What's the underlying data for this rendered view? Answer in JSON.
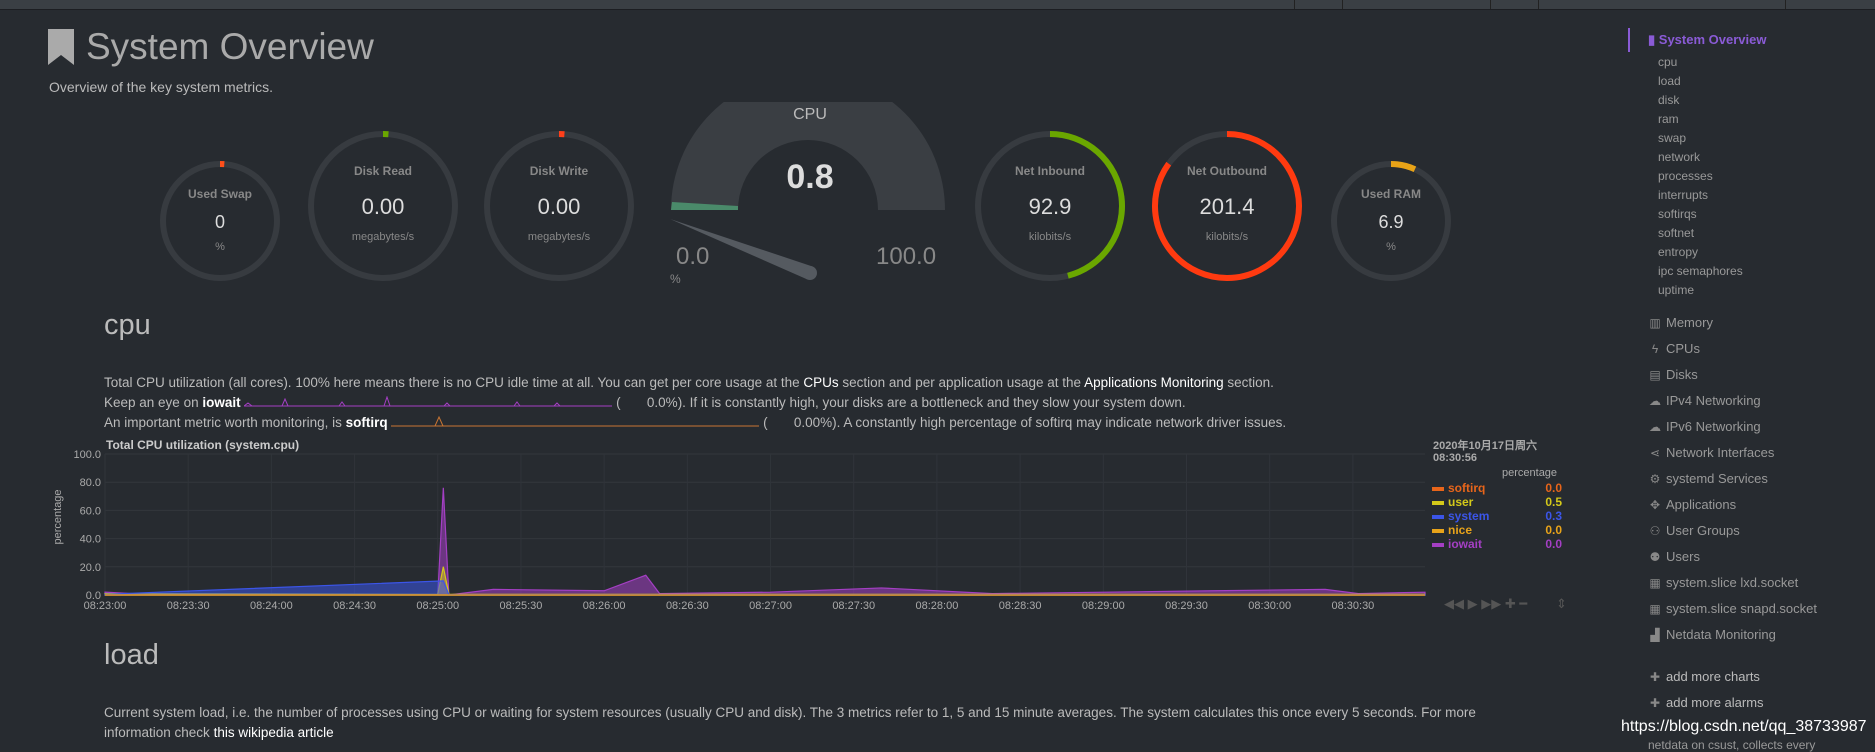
{
  "header": {
    "title": "System Overview",
    "subtitle": "Overview of the key system metrics."
  },
  "gauges": {
    "used_swap": {
      "title": "Used Swap",
      "value": "0",
      "unit": "%",
      "fill": 0.0,
      "color": "#ff4f1a"
    },
    "disk_read": {
      "title": "Disk Read",
      "value": "0.00",
      "unit": "megabytes/s",
      "fill": 0.0,
      "color": "#6aa700"
    },
    "disk_write": {
      "title": "Disk Write",
      "value": "0.00",
      "unit": "megabytes/s",
      "fill": 0.0,
      "color": "#ff3f1a"
    },
    "cpu": {
      "title": "CPU",
      "value": "0.8",
      "min": "0.0",
      "max": "100.0",
      "unit": "%",
      "fill": 0.008
    },
    "net_inbound": {
      "title": "Net Inbound",
      "value": "92.9",
      "unit": "kilobits/s",
      "fill": 0.46,
      "color": "#6aa700"
    },
    "net_outbound": {
      "title": "Net Outbound",
      "value": "201.4",
      "unit": "kilobits/s",
      "fill": 0.85,
      "color": "#ff3a10"
    },
    "used_ram": {
      "title": "Used RAM",
      "value": "6.9",
      "unit": "%",
      "fill": 0.069,
      "color": "#e8a317"
    }
  },
  "cpu_section": {
    "title": "cpu",
    "line1_a": "Total CPU utilization (all cores). 100% here means there is no CPU idle time at all. You can get per core usage at the ",
    "line1_link1": "CPUs",
    "line1_b": " section and per application usage at the ",
    "line1_link2": "Applications Monitoring",
    "line1_c": " section.",
    "line2_a": "Keep an eye on ",
    "line2_key": "iowait",
    "line2_val": "0.0%",
    "line2_b": "). If it is constantly high, your disks are a bottleneck and they slow your system down.",
    "line3_a": "An important metric worth monitoring, is ",
    "line3_key": "softirq",
    "line3_val": "0.00%",
    "line3_b": "). A constantly high percentage of softirq may indicate network driver issues."
  },
  "chart_header": {
    "title": "Total CPU utilization (system.cpu)",
    "timestamp_date": "2020年10月17日周六",
    "timestamp_time": "08:30:56",
    "value_label": "percentage"
  },
  "legend": [
    {
      "name": "softirq",
      "value": "0.0",
      "color": "#e8651a"
    },
    {
      "name": "user",
      "value": "0.5",
      "color": "#d4c91a"
    },
    {
      "name": "system",
      "value": "0.3",
      "color": "#3b55e8"
    },
    {
      "name": "nice",
      "value": "0.0",
      "color": "#e8a31a"
    },
    {
      "name": "iowait",
      "value": "0.0",
      "color": "#a43fc4"
    }
  ],
  "chart_data": {
    "type": "area",
    "title": "Total CPU utilization (system.cpu)",
    "ylabel": "percentage",
    "ylim": [
      0,
      100
    ],
    "yticks": [
      "0.0",
      "20.0",
      "40.0",
      "60.0",
      "80.0",
      "100.0"
    ],
    "xticks": [
      "08:23:00",
      "08:23:30",
      "08:24:00",
      "08:24:30",
      "08:25:00",
      "08:25:30",
      "08:26:00",
      "08:26:30",
      "08:27:00",
      "08:27:30",
      "08:28:00",
      "08:28:30",
      "08:29:00",
      "08:29:30",
      "08:30:00",
      "08:30:30"
    ],
    "xrange_seconds": [
      0,
      476
    ],
    "series": [
      {
        "name": "iowait",
        "points": [
          [
            0,
            2
          ],
          [
            10,
            1
          ],
          [
            60,
            0
          ],
          [
            120,
            0
          ],
          [
            122,
            76
          ],
          [
            124,
            0
          ],
          [
            140,
            4
          ],
          [
            180,
            3
          ],
          [
            195,
            14
          ],
          [
            200,
            1
          ],
          [
            240,
            2
          ],
          [
            280,
            5
          ],
          [
            320,
            1
          ],
          [
            400,
            3
          ],
          [
            440,
            4
          ],
          [
            452,
            1
          ],
          [
            476,
            2
          ]
        ]
      },
      {
        "name": "user",
        "points": [
          [
            0,
            1
          ],
          [
            120,
            0.5
          ],
          [
            122,
            20
          ],
          [
            124,
            0.5
          ],
          [
            200,
            0.5
          ],
          [
            476,
            0.5
          ]
        ]
      },
      {
        "name": "system",
        "points": [
          [
            0,
            0.5
          ],
          [
            122,
            10
          ],
          [
            124,
            0.3
          ],
          [
            476,
            0.3
          ]
        ]
      },
      {
        "name": "softirq",
        "points": [
          [
            0,
            0
          ],
          [
            476,
            0
          ]
        ]
      },
      {
        "name": "nice",
        "points": [
          [
            0,
            0
          ],
          [
            476,
            0
          ]
        ]
      }
    ]
  },
  "load_section": {
    "title": "load",
    "line1": "Current system load, i.e. the number of processes using CPU or waiting for system resources (usually CPU and disk). The 3 metrics refer to 1, 5 and 15 minute averages. The system calculates this once every 5 seconds. For more",
    "line2_a": "information check ",
    "line2_link": "this wikipedia article"
  },
  "sidebar": {
    "main": "System Overview",
    "sub_items": [
      "cpu",
      "load",
      "disk",
      "ram",
      "swap",
      "network",
      "processes",
      "interrupts",
      "softirqs",
      "softnet",
      "entropy",
      "ipc semaphores",
      "uptime"
    ],
    "items": [
      {
        "label": "Memory",
        "icon": "memory-icon",
        "glyph": "▥"
      },
      {
        "label": "CPUs",
        "icon": "bolt-icon",
        "glyph": "ϟ"
      },
      {
        "label": "Disks",
        "icon": "disk-icon",
        "glyph": "▤"
      },
      {
        "label": "IPv4 Networking",
        "icon": "cloud-icon",
        "glyph": "☁"
      },
      {
        "label": "IPv6 Networking",
        "icon": "cloud-icon",
        "glyph": "☁"
      },
      {
        "label": "Network Interfaces",
        "icon": "share-icon",
        "glyph": "⋖"
      },
      {
        "label": "systemd Services",
        "icon": "cogs-icon",
        "glyph": "⚙"
      },
      {
        "label": "Applications",
        "icon": "gamepad-icon",
        "glyph": "✥"
      },
      {
        "label": "User Groups",
        "icon": "users-icon",
        "glyph": "⚇"
      },
      {
        "label": "Users",
        "icon": "user-icon",
        "glyph": "⚉"
      },
      {
        "label": "system.slice lxd.socket",
        "icon": "grid-icon",
        "glyph": "▦"
      },
      {
        "label": "system.slice snapd.socket",
        "icon": "grid-icon",
        "glyph": "▦"
      },
      {
        "label": "Netdata Monitoring",
        "icon": "bar-chart-icon",
        "glyph": "▟"
      }
    ],
    "add_charts": "add more charts",
    "add_alarms": "add more alarms",
    "trailing": "netdata on csust, collects every"
  },
  "watermark": "https://blog.csdn.net/qq_38733987"
}
